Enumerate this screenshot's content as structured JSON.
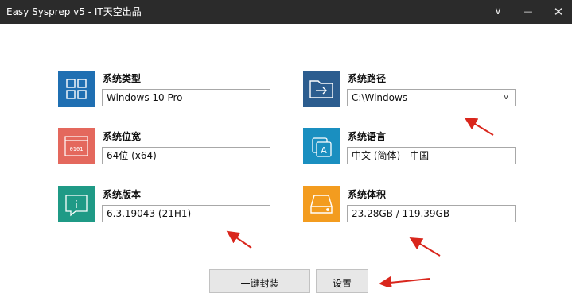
{
  "window": {
    "title": "Easy Sysprep v5 - IT天空出品",
    "minimize_glyph": "∨",
    "maximize_glyph": "—",
    "close_glyph": "✕"
  },
  "fields": {
    "os_type": {
      "label": "系统类型",
      "value": "Windows 10 Pro",
      "icon": "windows-grid-icon",
      "color": "#1f6fb2"
    },
    "os_path": {
      "label": "系统路径",
      "value": "C:\\Windows",
      "icon": "folder-arrow-icon",
      "color": "#2c5d8f",
      "dropdown_glyph": "v"
    },
    "os_bits": {
      "label": "系统位宽",
      "value": "64位 (x64)",
      "icon": "binary-window-icon",
      "color": "#e4685d"
    },
    "os_lang": {
      "label": "系统语言",
      "value": "中文 (简体) - 中国",
      "icon": "language-a-icon",
      "color": "#1a8fc0"
    },
    "os_version": {
      "label": "系统版本",
      "value": "6.3.19043 (21H1)",
      "icon": "info-icon",
      "color": "#1f9a86"
    },
    "os_size": {
      "label": "系统体积",
      "value": "23.28GB / 119.39GB",
      "icon": "hard-drive-icon",
      "color": "#f39c1f"
    }
  },
  "buttons": {
    "one_click_label": "一键封装",
    "settings_label": "设置"
  },
  "annotation_color": "#d9261c"
}
